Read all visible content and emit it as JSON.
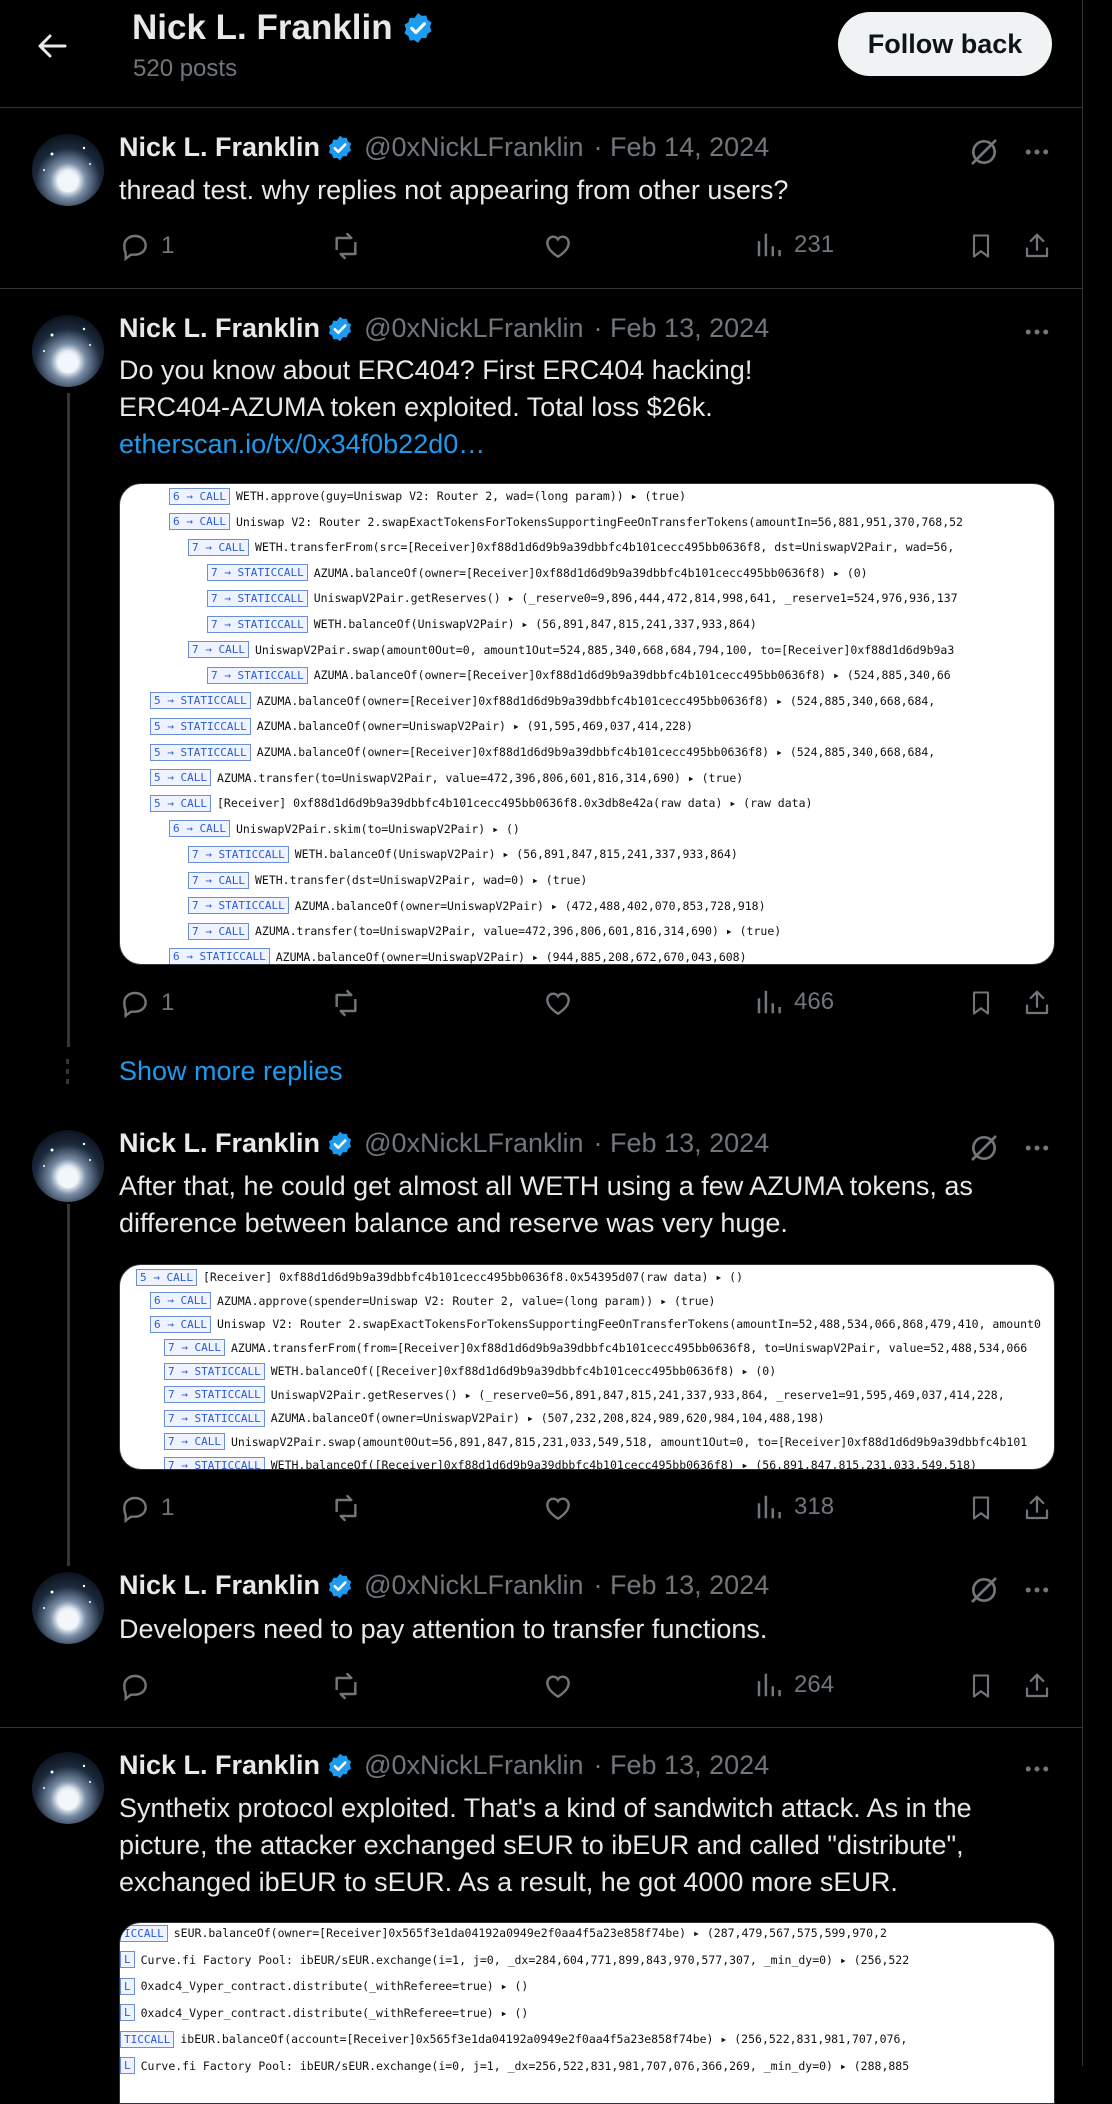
{
  "header": {
    "title": "Nick L. Franklin",
    "posts_count": "520 posts",
    "follow_label": "Follow back"
  },
  "posts": [
    {
      "name": "Nick L. Franklin",
      "handle": "@0xNickLFranklin",
      "date": "· Feb 14, 2024",
      "text": "thread test. why replies not appearing from other users?",
      "replies": "1",
      "views": "231"
    },
    {
      "name": "Nick L. Franklin",
      "handle": "@0xNickLFranklin",
      "date": "· Feb 13, 2024",
      "text_line1": "Do you know about ERC404? First ERC404 hacking!",
      "text_line2": "ERC404-AZUMA token exploited. Total loss $26k.",
      "link": "etherscan.io/tx/0x34f0b22d0…",
      "replies": "1",
      "views": "466"
    },
    {
      "name": "Nick L. Franklin",
      "handle": "@0xNickLFranklin",
      "date": "· Feb 13, 2024",
      "text": "After that, he could get almost all WETH using a few AZUMA tokens, as difference between balance and reserve was very huge.",
      "replies": "1",
      "views": "318"
    },
    {
      "name": "Nick L. Franklin",
      "handle": "@0xNickLFranklin",
      "date": "· Feb 13, 2024",
      "text": "Developers need to pay attention to transfer functions.",
      "views": "264"
    },
    {
      "name": "Nick L. Franklin",
      "handle": "@0xNickLFranklin",
      "date": "· Feb 13, 2024",
      "text": "Synthetix protocol exploited. That's a kind of sandwitch attack. As in the picture, the attacker exchanged sEUR to ibEUR and called \"distribute\", exchanged ibEUR to sEUR. As a result, he got 4000 more sEUR."
    }
  ],
  "show_more": "Show more replies",
  "trace1": [
    {
      "indent": 1,
      "badge": "6 → CALL",
      "body": "WETH.approve(guy=Uniswap V2: Router 2, wad=(long param))  ▸  (true)"
    },
    {
      "indent": 1,
      "badge": "6 → CALL",
      "body": "Uniswap V2: Router 2.swapExactTokensForTokensSupportingFeeOnTransferTokens(amountIn=56,881,951,370,768,52"
    },
    {
      "indent": 2,
      "badge": "7 → CALL",
      "body": "WETH.transferFrom(src=[Receiver]0xf88d1d6d9b9a39dbbfc4b101cecc495bb0636f8, dst=UniswapV2Pair, wad=56,"
    },
    {
      "indent": 3,
      "badge": "7 → STATICCALL",
      "body": "AZUMA.balanceOf(owner=[Receiver]0xf88d1d6d9b9a39dbbfc4b101cecc495bb0636f8)  ▸  (0)"
    },
    {
      "indent": 3,
      "badge": "7 → STATICCALL",
      "body": "UniswapV2Pair.getReserves()  ▸  (_reserve0=9,896,444,472,814,998,641, _reserve1=524,976,936,137"
    },
    {
      "indent": 3,
      "badge": "7 → STATICCALL",
      "body": "WETH.balanceOf(UniswapV2Pair)  ▸  (56,891,847,815,241,337,933,864)"
    },
    {
      "indent": 2,
      "badge": "7 → CALL",
      "body": "UniswapV2Pair.swap(amount0Out=0, amount1Out=524,885,340,668,684,794,100, to=[Receiver]0xf88d1d6d9b9a3"
    },
    {
      "indent": 3,
      "badge": "7 → STATICCALL",
      "body": "AZUMA.balanceOf(owner=[Receiver]0xf88d1d6d9b9a39dbbfc4b101cecc495bb0636f8)  ▸  (524,885,340,66"
    },
    {
      "indent": 0,
      "badge": "5 → STATICCALL",
      "body": "AZUMA.balanceOf(owner=[Receiver]0xf88d1d6d9b9a39dbbfc4b101cecc495bb0636f8)  ▸  (524,885,340,668,684,"
    },
    {
      "indent": 0,
      "badge": "5 → STATICCALL",
      "body": "AZUMA.balanceOf(owner=UniswapV2Pair)  ▸  (91,595,469,037,414,228)"
    },
    {
      "indent": 0,
      "badge": "5 → STATICCALL",
      "body": "AZUMA.balanceOf(owner=[Receiver]0xf88d1d6d9b9a39dbbfc4b101cecc495bb0636f8)  ▸  (524,885,340,668,684,"
    },
    {
      "indent": 0,
      "badge": "5 → CALL",
      "body": "AZUMA.transfer(to=UniswapV2Pair, value=472,396,806,601,816,314,690)  ▸  (true)"
    },
    {
      "indent": 0,
      "badge": "5 → CALL",
      "body": "[Receiver] 0xf88d1d6d9b9a39dbbfc4b101cecc495bb0636f8.0x3db8e42a(raw data)  ▸  (raw data)"
    },
    {
      "indent": 1,
      "badge": "6 → CALL",
      "body": "UniswapV2Pair.skim(to=UniswapV2Pair)  ▸  ()"
    },
    {
      "indent": 2,
      "badge": "7 → STATICCALL",
      "body": "WETH.balanceOf(UniswapV2Pair)  ▸  (56,891,847,815,241,337,933,864)"
    },
    {
      "indent": 2,
      "badge": "7 → CALL",
      "body": "WETH.transfer(dst=UniswapV2Pair, wad=0)  ▸  (true)"
    },
    {
      "indent": 2,
      "badge": "7 → STATICCALL",
      "body": "AZUMA.balanceOf(owner=UniswapV2Pair)  ▸  (472,488,402,070,853,728,918)"
    },
    {
      "indent": 2,
      "badge": "7 → CALL",
      "body": "AZUMA.transfer(to=UniswapV2Pair, value=472,396,806,601,816,314,690)  ▸  (true)"
    },
    {
      "indent": 1,
      "badge": "6 → STATICCALL",
      "body": "AZUMA.balanceOf(owner=UniswapV2Pair)  ▸  (944,885,208,672,670,043,608)"
    }
  ],
  "trace2": [
    {
      "indent": 0,
      "badge": "5 → CALL",
      "body": "[Receiver] 0xf88d1d6d9b9a39dbbfc4b101cecc495bb0636f8.0x54395d07(raw data)  ▸  ()"
    },
    {
      "indent": 1,
      "badge": "6 → CALL",
      "body": "AZUMA.approve(spender=Uniswap V2: Router 2, value=(long param))  ▸  (true)"
    },
    {
      "indent": 1,
      "badge": "6 → CALL",
      "body": "Uniswap V2: Router 2.swapExactTokensForTokensSupportingFeeOnTransferTokens(amountIn=52,488,534,066,868,479,410, amount0"
    },
    {
      "indent": 2,
      "badge": "7 → CALL",
      "body": "AZUMA.transferFrom(from=[Receiver]0xf88d1d6d9b9a39dbbfc4b101cecc495bb0636f8, to=UniswapV2Pair, value=52,488,534,066"
    },
    {
      "indent": 2,
      "badge": "7 → STATICCALL",
      "body": "WETH.balanceOf([Receiver]0xf88d1d6d9b9a39dbbfc4b101cecc495bb0636f8)  ▸  (0)"
    },
    {
      "indent": 2,
      "badge": "7 → STATICCALL",
      "body": "UniswapV2Pair.getReserves()  ▸  (_reserve0=56,891,847,815,241,337,933,864, _reserve1=91,595,469,037,414,228,"
    },
    {
      "indent": 2,
      "badge": "7 → STATICCALL",
      "body": "AZUMA.balanceOf(owner=UniswapV2Pair)  ▸  (507,232,208,824,989,620,984,104,488,198)"
    },
    {
      "indent": 2,
      "badge": "7 → CALL",
      "body": "UniswapV2Pair.swap(amount0Out=56,891,847,815,231,033,549,518, amount1Out=0, to=[Receiver]0xf88d1d6d9b9a39dbbfc4b101"
    },
    {
      "indent": 2,
      "badge": "7 → STATICCALL",
      "body": "WETH.balanceOf([Receiver]0xf88d1d6d9b9a39dbbfc4b101cecc495bb0636f8)  ▸  (56,891,847,815,231,033,549,518)"
    }
  ],
  "trace3": [
    {
      "badge": "ICCALL",
      "body": "sEUR.balanceOf(owner=[Receiver]0x565f3e1da04192a0949e2f0aa4f5a23e858f74be)  ▸  (287,479,567,575,599,970,2"
    },
    {
      "badge": "L",
      "body": "Curve.fi Factory Pool: ibEUR/sEUR.exchange(i=1, j=0, _dx=284,604,771,899,843,970,577,307, _min_dy=0)  ▸  (256,522"
    },
    {
      "badge": "L",
      "body": "0xadc4_Vyper_contract.distribute(_withReferee=true)  ▸  ()"
    },
    {
      "badge": "L",
      "body": "0xadc4_Vyper_contract.distribute(_withReferee=true)  ▸  ()"
    },
    {
      "badge": "TICCALL",
      "body": "ibEUR.balanceOf(account=[Receiver]0x565f3e1da04192a0949e2f0aa4f5a23e858f74be)  ▸  (256,522,831,981,707,076,"
    },
    {
      "badge": "L",
      "body": "Curve.fi Factory Pool: ibEUR/sEUR.exchange(i=0, j=1, _dx=256,522,831,981,707,076,366,269, _min_dy=0)  ▸  (288,885"
    }
  ],
  "colors": {
    "background": "#000000",
    "text": "#e7e9ea",
    "muted": "#71767b",
    "accent": "#1d9bf0",
    "border": "#2f3336"
  }
}
